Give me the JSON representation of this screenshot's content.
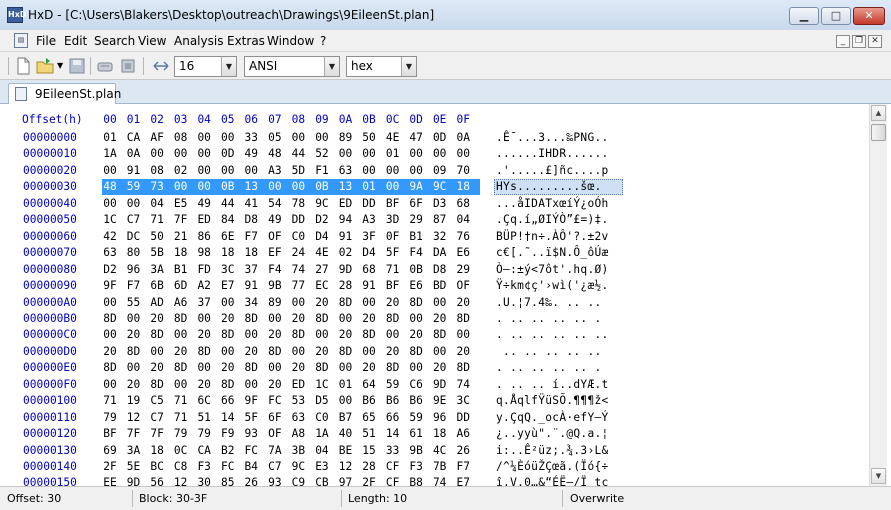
{
  "window": {
    "title": "HxD - [C:\\Users\\Blakers\\Desktop\\outreach\\Drawings\\9EileenSt.plan]",
    "icon_text": "HxD",
    "minimize_icon": "minimize-icon",
    "maximize_icon": "maximize-icon",
    "close_icon": "close-icon"
  },
  "menu": [
    "File",
    "Edit",
    "Search",
    "View",
    "Analysis",
    "Extras",
    "Window",
    "?"
  ],
  "toolbar": {
    "bytes_per_row": "16",
    "charset": "ANSI",
    "offset_base": "hex"
  },
  "tab": {
    "label": "9EileenSt.plan"
  },
  "editor": {
    "offset_header": "Offset(h)",
    "columns": [
      "00",
      "01",
      "02",
      "03",
      "04",
      "05",
      "06",
      "07",
      "08",
      "09",
      "0A",
      "0B",
      "0C",
      "0D",
      "0E",
      "0F"
    ],
    "selected_row": 3,
    "rows": [
      {
        "offset": "00000000",
        "bytes": [
          "01",
          "CA",
          "AF",
          "08",
          "00",
          "00",
          "33",
          "05",
          "00",
          "00",
          "89",
          "50",
          "4E",
          "47",
          "0D",
          "0A"
        ],
        "text": ".Ê¯...3...‰PNG.."
      },
      {
        "offset": "00000010",
        "bytes": [
          "1A",
          "0A",
          "00",
          "00",
          "00",
          "0D",
          "49",
          "48",
          "44",
          "52",
          "00",
          "00",
          "01",
          "00",
          "00",
          "00"
        ],
        "text": "......IHDR......"
      },
      {
        "offset": "00000020",
        "bytes": [
          "00",
          "91",
          "08",
          "02",
          "00",
          "00",
          "00",
          "A3",
          "5D",
          "F1",
          "63",
          "00",
          "00",
          "00",
          "09",
          "70"
        ],
        "text": ".'.....£]ñc....p"
      },
      {
        "offset": "00000030",
        "bytes": [
          "48",
          "59",
          "73",
          "00",
          "00",
          "0B",
          "13",
          "00",
          "00",
          "0B",
          "13",
          "01",
          "00",
          "9A",
          "9C",
          "18"
        ],
        "text": "HYs.........šœ."
      },
      {
        "offset": "00000040",
        "bytes": [
          "00",
          "00",
          "04",
          "E5",
          "49",
          "44",
          "41",
          "54",
          "78",
          "9C",
          "ED",
          "DD",
          "BF",
          "6F",
          "D3",
          "68"
        ],
        "text": "...åIDATxœíÝ¿oÓh"
      },
      {
        "offset": "00000050",
        "bytes": [
          "1C",
          "C7",
          "71",
          "7F",
          "ED",
          "84",
          "D8",
          "49",
          "DD",
          "D2",
          "94",
          "A3",
          "3D",
          "29",
          "87",
          "04"
        ],
        "text": ".Çq.í„ØIÝÒ”£=)‡."
      },
      {
        "offset": "00000060",
        "bytes": [
          "42",
          "DC",
          "50",
          "21",
          "86",
          "6E",
          "F7",
          "OF",
          "C0",
          "D4",
          "91",
          "3F",
          "0F",
          "B1",
          "32",
          "76"
        ],
        "text": "BÜP!†n÷.ÀÔ'?.±2v"
      },
      {
        "offset": "00000070",
        "bytes": [
          "63",
          "80",
          "5B",
          "18",
          "98",
          "18",
          "18",
          "EF",
          "24",
          "4E",
          "02",
          "D4",
          "5F",
          "F4",
          "DA",
          "E6"
        ],
        "text": "c€[.˜..ï$N.Ô_ôÚæ"
      },
      {
        "offset": "00000080",
        "bytes": [
          "D2",
          "96",
          "3A",
          "B1",
          "FD",
          "3C",
          "37",
          "F4",
          "74",
          "27",
          "9D",
          "68",
          "71",
          "0B",
          "D8",
          "29"
        ],
        "text": "Ò–:±ý<7ôt'.hq.Ø)"
      },
      {
        "offset": "00000090",
        "bytes": [
          "9F",
          "F7",
          "6B",
          "6D",
          "A2",
          "E7",
          "91",
          "9B",
          "77",
          "EC",
          "28",
          "91",
          "BF",
          "E6",
          "BD",
          "OF"
        ],
        "text": "Ÿ÷km¢ç'›wì('¿æ½."
      },
      {
        "offset": "000000A0",
        "bytes": [
          "00",
          "55",
          "AD",
          "A6",
          "37",
          "00",
          "34",
          "89",
          "00",
          "20",
          "8D",
          "00",
          "20",
          "8D",
          "00",
          "20"
        ],
        "text": ".U.¦7.4‰. .. .. "
      },
      {
        "offset": "000000B0",
        "bytes": [
          "8D",
          "00",
          "20",
          "8D",
          "00",
          "20",
          "8D",
          "00",
          "20",
          "8D",
          "00",
          "20",
          "8D",
          "00",
          "20",
          "8D"
        ],
        "text": ". .. .. .. .. ."
      },
      {
        "offset": "000000C0",
        "bytes": [
          "00",
          "20",
          "8D",
          "00",
          "20",
          "8D",
          "00",
          "20",
          "8D",
          "00",
          "20",
          "8D",
          "00",
          "20",
          "8D",
          "00"
        ],
        "text": ". .. .. .. .. .."
      },
      {
        "offset": "000000D0",
        "bytes": [
          "20",
          "8D",
          "00",
          "20",
          "8D",
          "00",
          "20",
          "8D",
          "00",
          "20",
          "8D",
          "00",
          "20",
          "8D",
          "00",
          "20"
        ],
        "text": " .. .. .. .. .. "
      },
      {
        "offset": "000000E0",
        "bytes": [
          "8D",
          "00",
          "20",
          "8D",
          "00",
          "20",
          "8D",
          "00",
          "20",
          "8D",
          "00",
          "20",
          "8D",
          "00",
          "20",
          "8D"
        ],
        "text": ". .. .. .. .. ."
      },
      {
        "offset": "000000F0",
        "bytes": [
          "00",
          "20",
          "8D",
          "00",
          "20",
          "8D",
          "00",
          "20",
          "ED",
          "1C",
          "01",
          "64",
          "59",
          "C6",
          "9D",
          "74"
        ],
        "text": ". .. .. í..dYÆ.t"
      },
      {
        "offset": "00000100",
        "bytes": [
          "71",
          "19",
          "C5",
          "71",
          "6C",
          "66",
          "9F",
          "FC",
          "53",
          "D5",
          "00",
          "B6",
          "B6",
          "B6",
          "9E",
          "3C"
        ],
        "text": "q.ÅqlfŸüSÕ.¶¶¶ž<"
      },
      {
        "offset": "00000110",
        "bytes": [
          "79",
          "12",
          "C7",
          "71",
          "51",
          "14",
          "5F",
          "6F",
          "63",
          "C0",
          "B7",
          "65",
          "66",
          "59",
          "96",
          "DD"
        ],
        "text": "y.ÇqQ._ocÀ·efY–Ý"
      },
      {
        "offset": "00000120",
        "bytes": [
          "BF",
          "7F",
          "7F",
          "79",
          "79",
          "F9",
          "93",
          "OF",
          "A8",
          "1A",
          "40",
          "51",
          "14",
          "61",
          "18",
          "A6"
        ],
        "text": "¿..yyù\".¨.@Q.a.¦"
      },
      {
        "offset": "00000130",
        "bytes": [
          "69",
          "3A",
          "18",
          "0C",
          "CA",
          "B2",
          "FC",
          "7A",
          "3B",
          "04",
          "BE",
          "15",
          "33",
          "9B",
          "4C",
          "26"
        ],
        "text": "i:..Ê²üz;.¾.3›L&"
      },
      {
        "offset": "00000140",
        "bytes": [
          "2F",
          "5E",
          "BC",
          "C8",
          "F3",
          "FC",
          "B4",
          "C7",
          "9C",
          "E3",
          "12",
          "28",
          "CF",
          "F3",
          "7B",
          "F7"
        ],
        "text": "/^¼ÈóüŽÇœã.(Ïó{÷"
      },
      {
        "offset": "00000150",
        "bytes": [
          "EE",
          "9D",
          "56",
          "12",
          "30",
          "85",
          "26",
          "93",
          "C9",
          "CB",
          "97",
          "2F",
          "CF",
          "B8",
          "74",
          "E7"
        ],
        "text": "î.V.0…&“ÉË—/Ï¸tç"
      }
    ]
  },
  "status": {
    "offset": "Offset: 30",
    "block": "Block: 30-3F",
    "length": "Length: 10",
    "mode": "Overwrite"
  }
}
